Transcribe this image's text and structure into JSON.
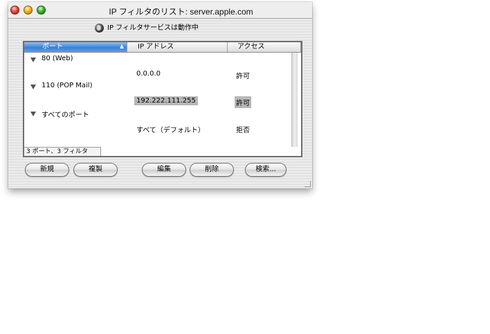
{
  "window": {
    "title": "IP フィルタのリスト: server.apple.com",
    "status_text": "IP フィルタサービスは動作中"
  },
  "table": {
    "columns": {
      "port": "ポート",
      "ip": "IP アドレス",
      "access": "アクセス"
    },
    "groups": [
      {
        "label": "80 (Web)",
        "ip": "0.0.0.0",
        "access": "許可",
        "selected": false
      },
      {
        "label": "110 (POP Mail)",
        "ip": "192.222.111.255",
        "access": "許可",
        "selected": true
      },
      {
        "label": "すべてのポート",
        "ip": "すべて（デフォルト）",
        "access": "拒否",
        "selected": false
      }
    ],
    "footer": "3 ポート、3 フィルタ"
  },
  "buttons": {
    "new": "新規",
    "duplicate": "複製",
    "edit": "編集",
    "delete": "削除",
    "search": "検索..."
  }
}
